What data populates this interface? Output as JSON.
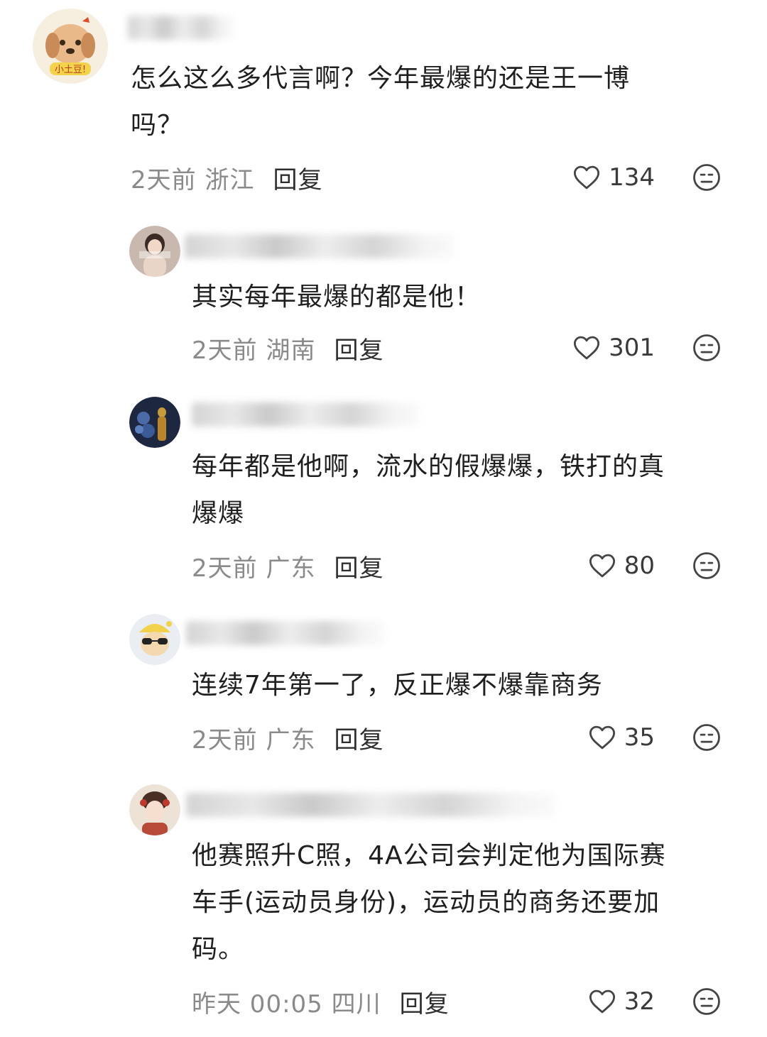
{
  "comments": [
    {
      "text": "怎么这么多代言啊？今年最爆的还是王一博\n吗？",
      "time": "2天前 浙江",
      "reply": "回复",
      "likes": "134",
      "avatar_label": "小土豆!"
    },
    {
      "text": "其实每年最爆的都是他！",
      "time": "2天前 湖南",
      "reply": "回复",
      "likes": "301"
    },
    {
      "text": "每年都是他啊，流水的假爆爆，铁打的真\n爆爆",
      "time": "2天前 广东",
      "reply": "回复",
      "likes": "80"
    },
    {
      "text": "连续7年第一了，反正爆不爆靠商务",
      "time": "2天前 广东",
      "reply": "回复",
      "likes": "35"
    },
    {
      "text": "他赛照升C照，4A公司会判定他为国际赛\n车手(运动员身份)，运动员的商务还要加\n码。",
      "time": "昨天 00:05 四川",
      "reply": "回复",
      "likes": "32"
    }
  ],
  "icons": {
    "like": "heart-outline-icon",
    "dislike": "meh-face-icon"
  },
  "colors": {
    "text": "#1f1f1f",
    "meta": "#8a8a8a",
    "icon": "#444444"
  }
}
